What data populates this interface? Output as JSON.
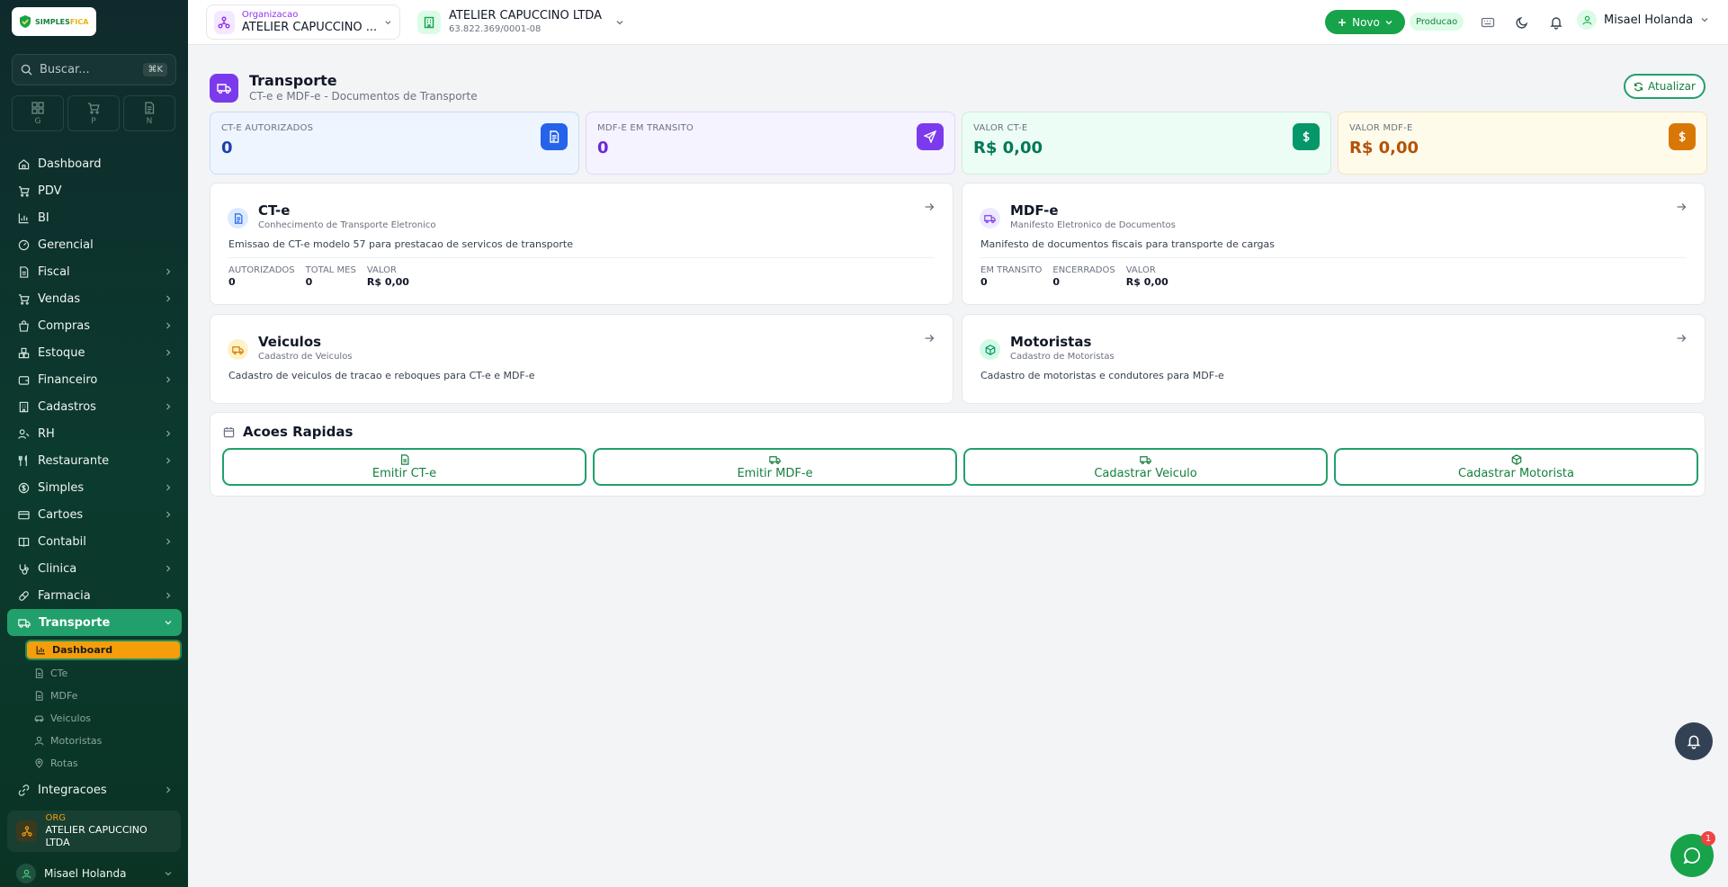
{
  "brand": {
    "logo_part1": "SIMPLES",
    "logo_part2": "FICA"
  },
  "search": {
    "placeholder": "Buscar...",
    "shortcut": "⌘K"
  },
  "quick_tiles": [
    {
      "label": "G",
      "icon": "grid-icon"
    },
    {
      "label": "P",
      "icon": "cart-icon"
    },
    {
      "label": "N",
      "icon": "document-icon"
    }
  ],
  "nav": [
    {
      "label": "Dashboard",
      "icon": "home-icon",
      "chevron": false
    },
    {
      "label": "PDV",
      "icon": "cart-icon",
      "chevron": false
    },
    {
      "label": "BI",
      "icon": "bar-chart-icon",
      "chevron": false
    },
    {
      "label": "Gerencial",
      "icon": "gauge-icon",
      "chevron": false
    },
    {
      "label": "Fiscal",
      "icon": "file-icon",
      "chevron": true
    },
    {
      "label": "Vendas",
      "icon": "cart-icon",
      "chevron": true
    },
    {
      "label": "Compras",
      "icon": "bag-icon",
      "chevron": true
    },
    {
      "label": "Estoque",
      "icon": "boxes-icon",
      "chevron": true
    },
    {
      "label": "Financeiro",
      "icon": "wallet-icon",
      "chevron": true
    },
    {
      "label": "Cadastros",
      "icon": "building-icon",
      "chevron": true
    },
    {
      "label": "RH",
      "icon": "users-icon",
      "chevron": true
    },
    {
      "label": "Restaurante",
      "icon": "utensils-icon",
      "chevron": true
    },
    {
      "label": "Simples",
      "icon": "dollar-circle-icon",
      "chevron": true
    },
    {
      "label": "Cartoes",
      "icon": "credit-card-icon",
      "chevron": true
    },
    {
      "label": "Contabil",
      "icon": "book-icon",
      "chevron": true
    },
    {
      "label": "Clinica",
      "icon": "stethoscope-icon",
      "chevron": true
    },
    {
      "label": "Farmacia",
      "icon": "pill-icon",
      "chevron": true
    }
  ],
  "nav_active": {
    "label": "Transporte"
  },
  "sub_nav": [
    {
      "label": "Dashboard",
      "icon": "bar-chart-icon",
      "active": true
    },
    {
      "label": "CTe",
      "icon": "file-icon",
      "active": false
    },
    {
      "label": "MDFe",
      "icon": "file-icon",
      "active": false
    },
    {
      "label": "Veiculos",
      "icon": "car-icon",
      "active": false
    },
    {
      "label": "Motoristas",
      "icon": "user-icon",
      "active": false
    },
    {
      "label": "Rotas",
      "icon": "map-pin-icon",
      "active": false
    }
  ],
  "nav_after": {
    "label": "Integracoes"
  },
  "sidebar_org": {
    "tag": "ORG",
    "name": "ATELIER CAPUCCINO LTDA"
  },
  "sidebar_user": {
    "name": "Misael Holanda"
  },
  "topbar": {
    "org_label": "Organizacao",
    "org_name": "ATELIER CAPUCCINO ...",
    "company_name": "ATELIER CAPUCCINO LTDA",
    "company_cnpj": "63.822.369/0001-08",
    "new_button": "Novo",
    "env_badge": "Producao",
    "user_name": "Misael Holanda"
  },
  "page": {
    "title": "Transporte",
    "subtitle": "CT-e e MDF-e - Documentos de Transporte",
    "refresh": "Atualizar"
  },
  "stats": [
    {
      "label": "CT-E AUTORIZADOS",
      "value": "0",
      "bg": "#eef5ff",
      "color": "#1e40af",
      "icon_bg": "#2563eb",
      "icon": "document-icon"
    },
    {
      "label": "MDF-E EM TRANSITO",
      "value": "0",
      "bg": "#f5f3ff",
      "color": "#6d28d9",
      "icon_bg": "#7c3aed",
      "icon": "send-icon"
    },
    {
      "label": "VALOR CT-E",
      "value": "R$ 0,00",
      "bg": "#ecfdf5",
      "color": "#047857",
      "icon_bg": "#059669",
      "icon": "dollar-icon"
    },
    {
      "label": "VALOR MDF-E",
      "value": "R$ 0,00",
      "bg": "#fffbeb",
      "color": "#b45309",
      "icon_bg": "#d97706",
      "icon": "dollar-icon"
    }
  ],
  "cards": {
    "cte": {
      "title": "CT-e",
      "subtitle": "Conhecimento de Transporte Eletronico",
      "desc": "Emissao de CT-e modelo 57 para prestacao de servicos de transporte",
      "metrics": [
        {
          "label": "AUTORIZADOS",
          "value": "0"
        },
        {
          "label": "TOTAL MES",
          "value": "0"
        },
        {
          "label": "VALOR",
          "value": "R$ 0,00"
        }
      ]
    },
    "mdfe": {
      "title": "MDF-e",
      "subtitle": "Manifesto Eletronico de Documentos",
      "desc": "Manifesto de documentos fiscais para transporte de cargas",
      "metrics": [
        {
          "label": "EM TRANSITO",
          "value": "0"
        },
        {
          "label": "ENCERRADOS",
          "value": "0"
        },
        {
          "label": "VALOR",
          "value": "R$ 0,00"
        }
      ]
    },
    "veiculos": {
      "title": "Veiculos",
      "subtitle": "Cadastro de Veiculos",
      "desc": "Cadastro de veiculos de tracao e reboques para CT-e e MDF-e"
    },
    "motoristas": {
      "title": "Motoristas",
      "subtitle": "Cadastro de Motoristas",
      "desc": "Cadastro de motoristas e condutores para MDF-e"
    }
  },
  "quick_actions": {
    "title": "Acoes Rapidas",
    "buttons": [
      {
        "label": "Emitir CT-e",
        "icon": "file-icon"
      },
      {
        "label": "Emitir MDF-e",
        "icon": "truck-icon"
      },
      {
        "label": "Cadastrar Veiculo",
        "icon": "truck-icon"
      },
      {
        "label": "Cadastrar Motorista",
        "icon": "box-icon"
      }
    ]
  },
  "chat_badge": "1"
}
